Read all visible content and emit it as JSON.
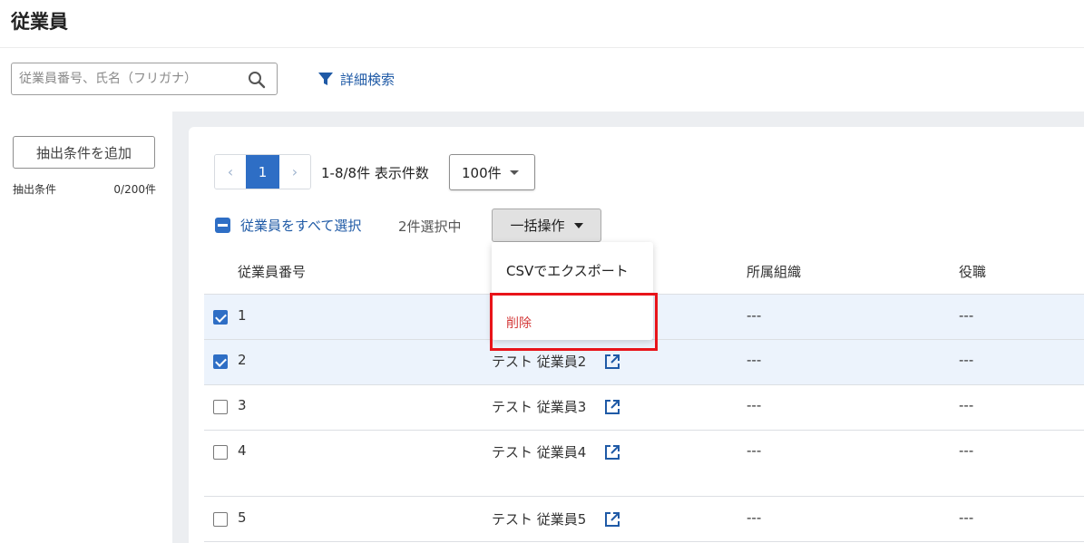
{
  "page": {
    "title": "従業員"
  },
  "search": {
    "placeholder": "従業員番号、氏名（フリガナ）",
    "icon": "search-icon"
  },
  "advanced_search": {
    "label": "詳細検索",
    "icon": "filter-icon"
  },
  "sidebar": {
    "add_condition_label": "抽出条件を追加",
    "conditions_label": "抽出条件",
    "conditions_count": "0/200件"
  },
  "pagination": {
    "prev": "‹",
    "current": "1",
    "next": "›",
    "range_text": "1-8/8件 表示件数",
    "per_page": "100件"
  },
  "selection": {
    "select_all_label": "従業員をすべて選択",
    "selected_count": "2件選択中",
    "bulk_action_label": "一括操作"
  },
  "bulk_menu": {
    "items": [
      "CSVでエクスポート",
      "削除"
    ]
  },
  "table": {
    "columns": [
      "従業員番号",
      "所属組織",
      "役職"
    ],
    "rows": [
      {
        "number": "1",
        "checked": true,
        "name": "",
        "org": "---",
        "position": "---"
      },
      {
        "number": "2",
        "checked": true,
        "name": "テスト 従業員2",
        "org": "---",
        "position": "---"
      },
      {
        "number": "3",
        "checked": false,
        "name": "テスト 従業員3",
        "org": "---",
        "position": "---"
      },
      {
        "number": "4",
        "checked": false,
        "name": "テスト 従業員4",
        "org": "---",
        "position": "---"
      },
      {
        "number": "5",
        "checked": false,
        "name": "テスト 従業員5",
        "org": "---",
        "position": "---"
      }
    ]
  },
  "colors": {
    "accent": "#2e6ec5",
    "link": "#1f5aa6",
    "danger": "#d43b3b",
    "highlight": "#e8141a",
    "selected_row": "#ecf3fc"
  }
}
